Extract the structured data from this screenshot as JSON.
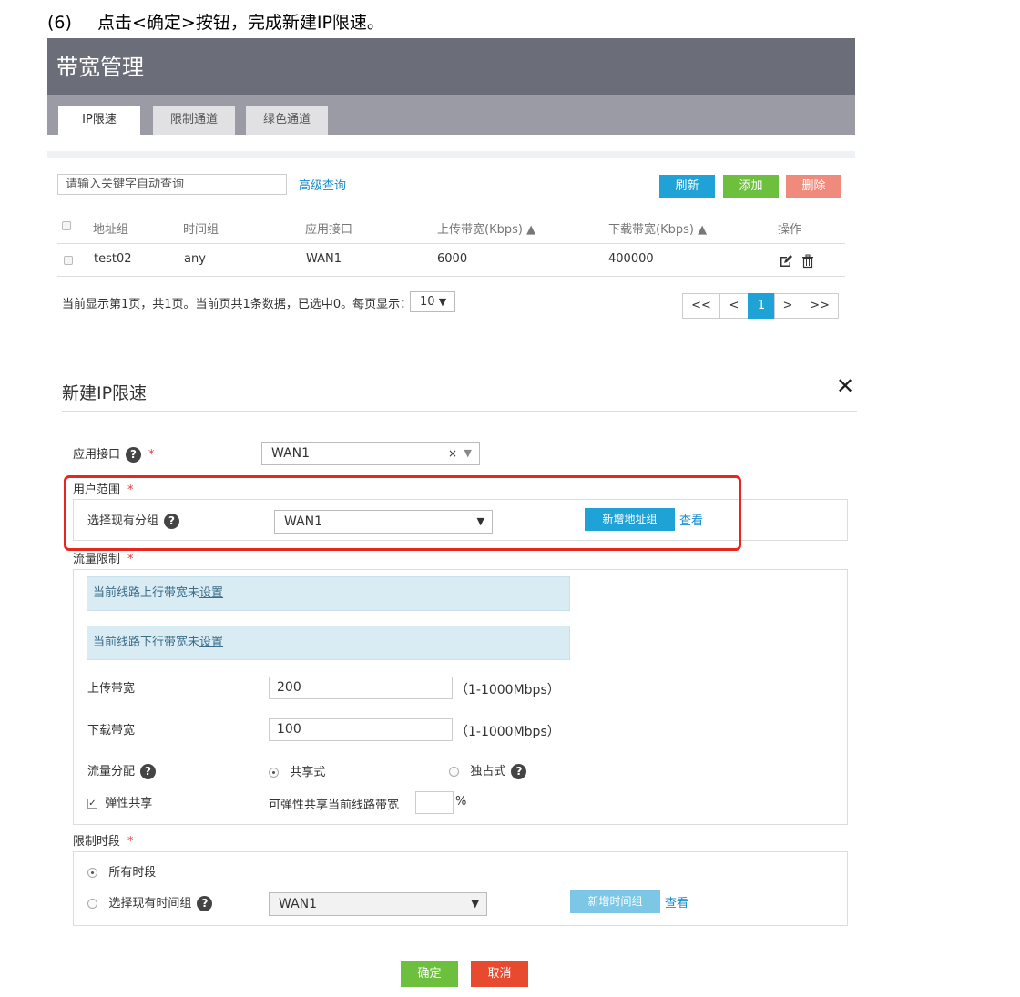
{
  "step": {
    "number": "(6)",
    "text": "点击<确定>按钮，完成新建IP限速。"
  },
  "page": {
    "title": "带宽管理",
    "tabs": [
      "IP限速",
      "限制通道",
      "绿色通道"
    ],
    "search_placeholder": "请输入关键字自动查询",
    "advanced_query": "高级查询",
    "buttons": {
      "refresh": "刷新",
      "add": "添加",
      "delete": "删除"
    },
    "table": {
      "headers": [
        "地址组",
        "时间组",
        "应用接口",
        "上传带宽(Kbps)",
        "下载带宽(Kbps)",
        "操作"
      ],
      "rows": [
        {
          "address_group": "test02",
          "time_group": "any",
          "interface": "WAN1",
          "upload": "6000",
          "download": "400000"
        }
      ]
    },
    "pagination": {
      "info": "当前显示第1页，共1页。当前页共1条数据，已选中0。每页显示：",
      "page_size": "10",
      "first": "<<",
      "prev": "<",
      "current": "1",
      "next": ">",
      "last": ">>"
    }
  },
  "dialog": {
    "title": "新建IP限速",
    "close": "✕",
    "interface": {
      "label": "应用接口",
      "value": "WAN1"
    },
    "user_scope": {
      "label": "用户范围",
      "select_label": "选择现有分组",
      "select_value": "WAN1",
      "new_button": "新增地址组",
      "view": "查看"
    },
    "flow_limit": {
      "label": "流量限制",
      "upload_notice": "当前线路上行带宽未",
      "download_notice": "当前线路下行带宽未",
      "setup_link": "设置",
      "upload_label": "上传带宽",
      "upload_value": "200",
      "upload_range": "（1-1000Mbps）",
      "download_label": "下载带宽",
      "download_value": "100",
      "download_range": "（1-1000Mbps）",
      "distribution_label": "流量分配",
      "shared": "共享式",
      "exclusive": "独占式",
      "elastic_label": "弹性共享",
      "elastic_desc": "可弹性共享当前线路带宽",
      "percent": "%"
    },
    "time_limit": {
      "label": "限制时段",
      "all_time": "所有时段",
      "select_group": "选择现有时间组",
      "select_value": "WAN1",
      "new_button": "新增时间组",
      "view": "查看"
    },
    "confirm": "确定",
    "cancel": "取消"
  },
  "colors": {
    "highlight": "#e8261e",
    "primary": "#1fa2d6",
    "green": "#6dbf3e",
    "danger": "#f08a7d",
    "cancel": "#e84a2f"
  }
}
